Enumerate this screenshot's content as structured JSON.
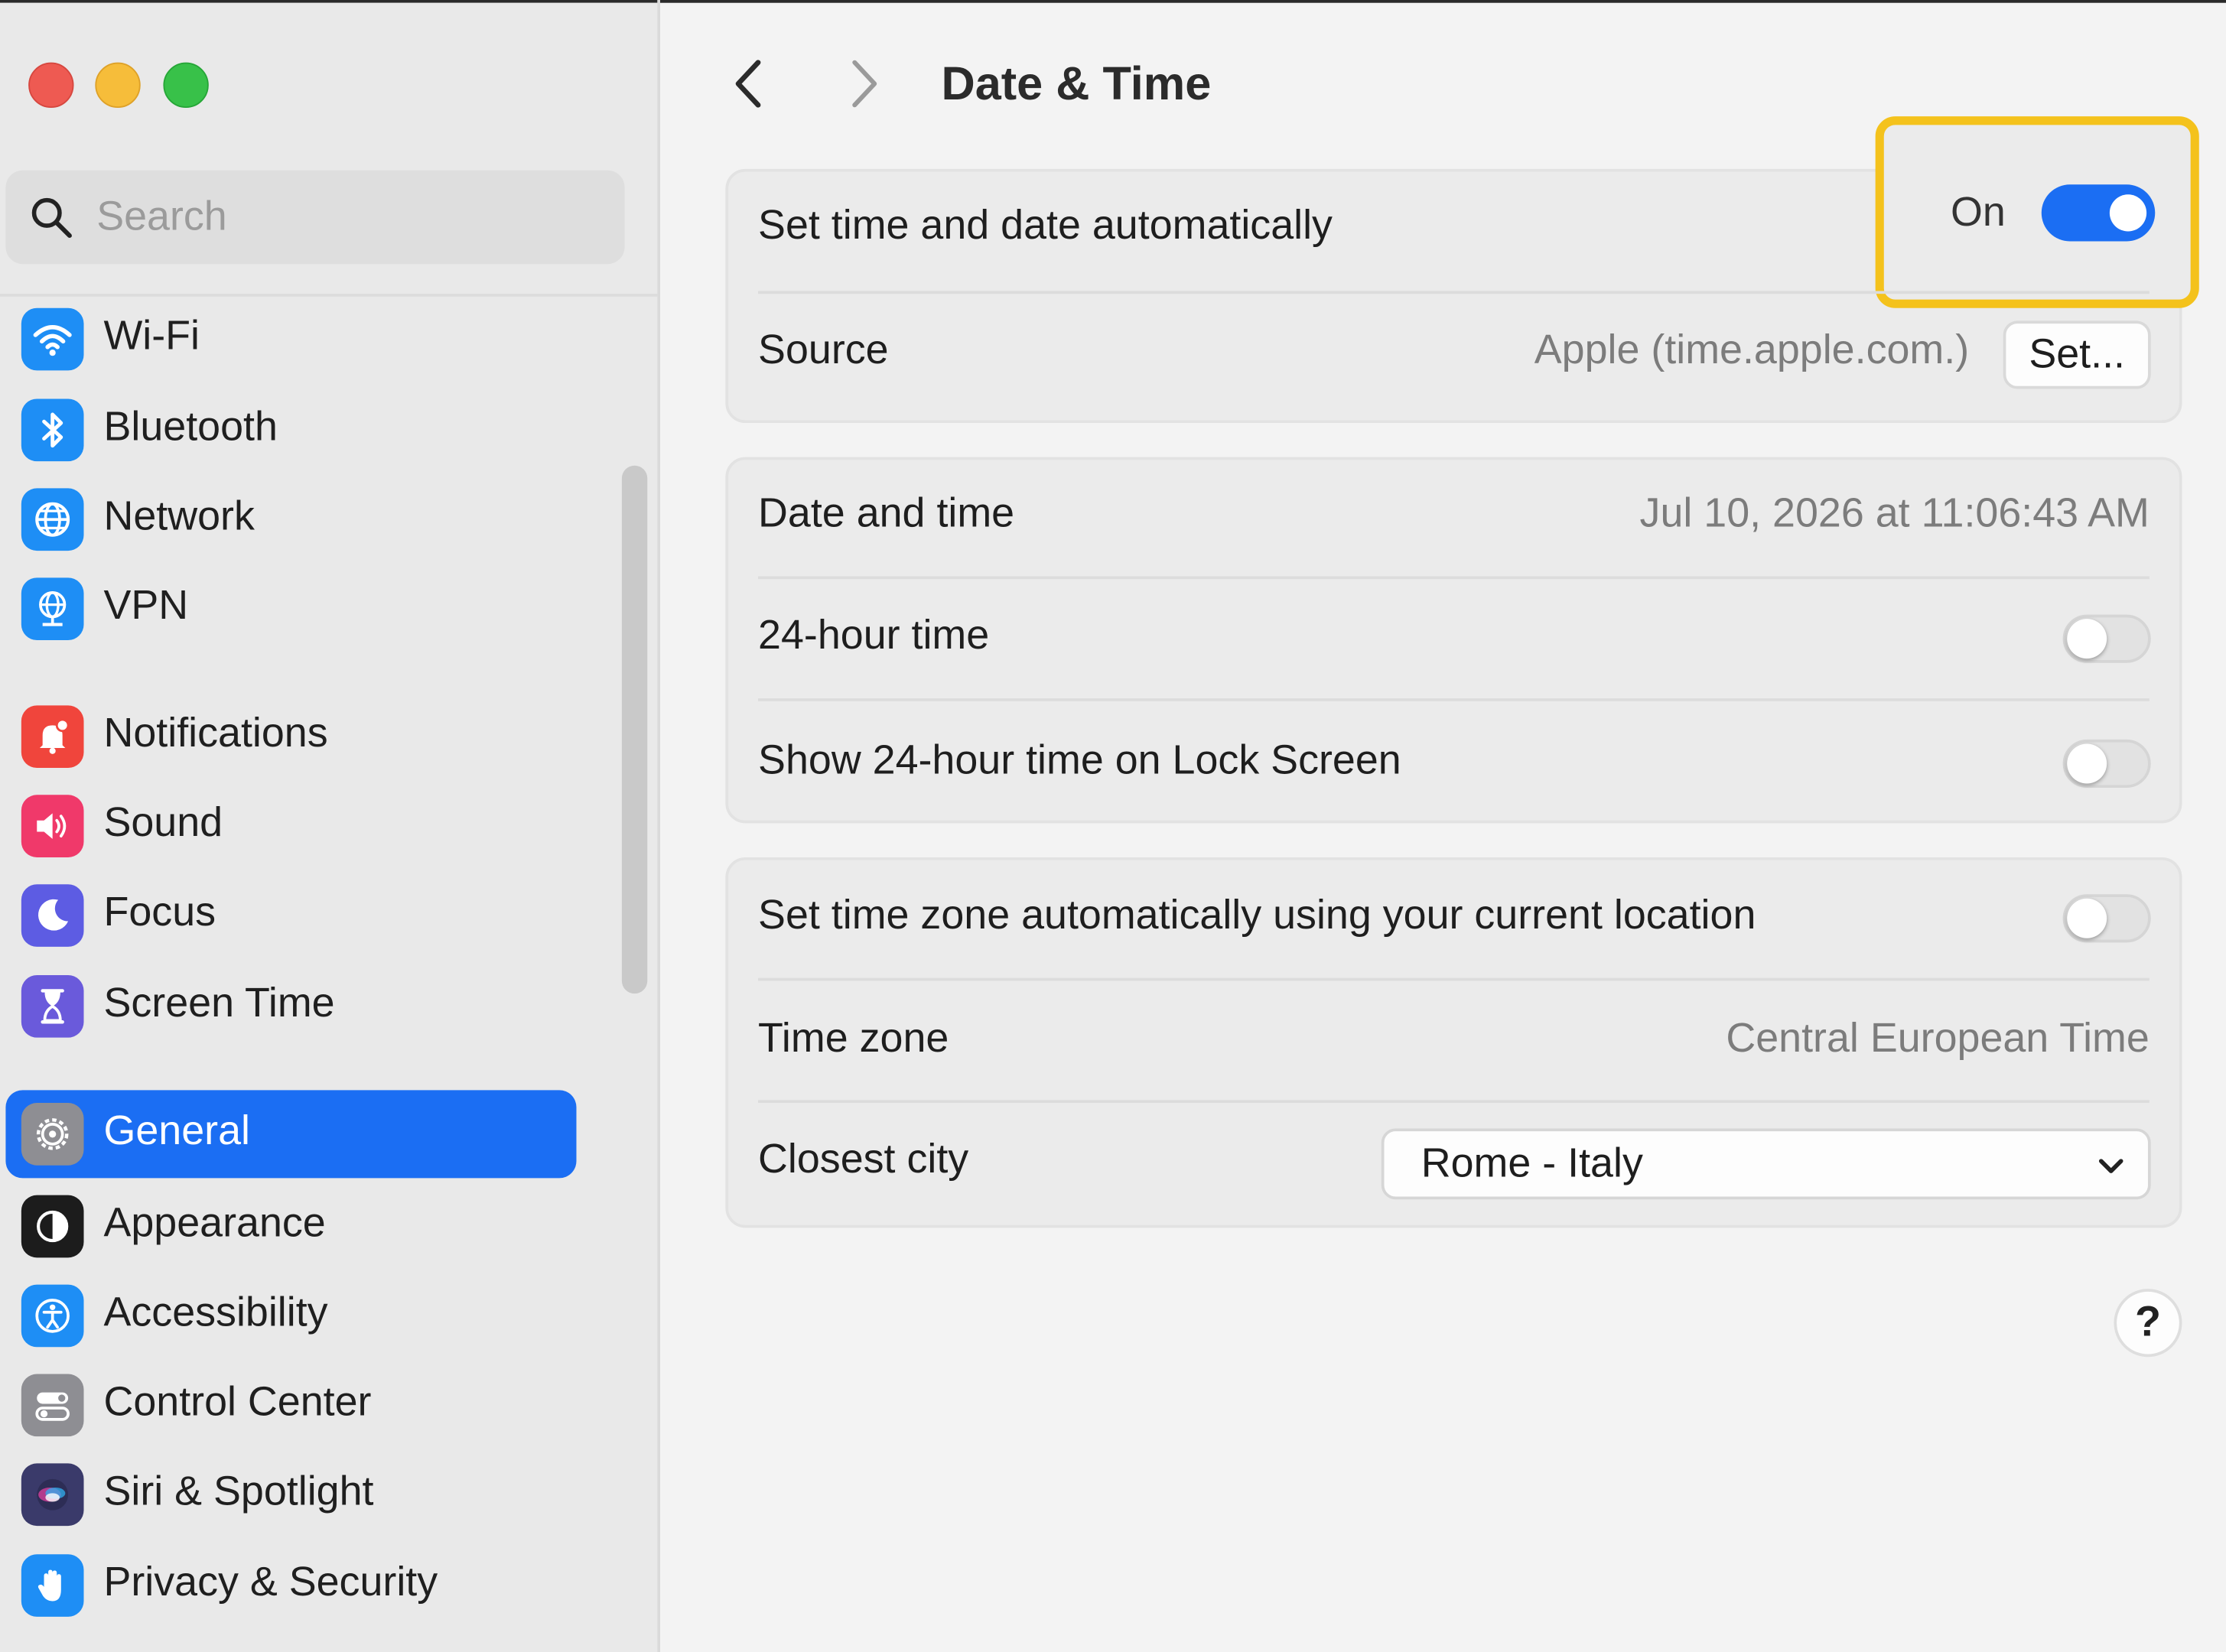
{
  "window": {
    "title": "Date & Time"
  },
  "sidebar": {
    "search": {
      "placeholder": "Search"
    },
    "items": [
      {
        "label": "Wi-Fi",
        "icon": "wifi-icon",
        "color": "#1e8ef5"
      },
      {
        "label": "Bluetooth",
        "icon": "bluetooth-icon",
        "color": "#1e8ef5"
      },
      {
        "label": "Network",
        "icon": "globe-icon",
        "color": "#1e8ef5"
      },
      {
        "label": "VPN",
        "icon": "vpn-globe-icon",
        "color": "#1e8ef5"
      },
      {
        "label": "Notifications",
        "icon": "bell-icon",
        "color": "#f0453c"
      },
      {
        "label": "Sound",
        "icon": "speaker-icon",
        "color": "#f0396a"
      },
      {
        "label": "Focus",
        "icon": "moon-icon",
        "color": "#5d5ce3"
      },
      {
        "label": "Screen Time",
        "icon": "hourglass-icon",
        "color": "#6a5adb"
      },
      {
        "label": "General",
        "icon": "gear-icon",
        "color": "#8e8e93",
        "selected": true
      },
      {
        "label": "Appearance",
        "icon": "appearance-icon",
        "color": "#1c1c1c"
      },
      {
        "label": "Accessibility",
        "icon": "accessibility-icon",
        "color": "#1e8ef5"
      },
      {
        "label": "Control Center",
        "icon": "control-center-icon",
        "color": "#8e8e93"
      },
      {
        "label": "Siri & Spotlight",
        "icon": "siri-icon",
        "color": "#3a3a6a"
      },
      {
        "label": "Privacy & Security",
        "icon": "hand-icon",
        "color": "#1e8ef5"
      }
    ]
  },
  "settings": {
    "auto_time": {
      "label": "Set time and date automatically",
      "state_label": "On",
      "enabled": true
    },
    "source": {
      "label": "Source",
      "value": "Apple (time.apple.com.)",
      "button": "Set..."
    },
    "date_time": {
      "label": "Date and time",
      "value": "Jul 10, 2026 at 11:06:43 AM"
    },
    "hour24": {
      "label": "24-hour time",
      "enabled": false
    },
    "hour24_lock": {
      "label": "Show 24-hour time on Lock Screen",
      "enabled": false
    },
    "auto_timezone": {
      "label": "Set time zone automatically using your current location",
      "enabled": false
    },
    "time_zone": {
      "label": "Time zone",
      "value": "Central European Time"
    },
    "closest_city": {
      "label": "Closest city",
      "value": "Rome - Italy"
    },
    "help": "?"
  },
  "colors": {
    "accent": "#1b6ef3",
    "highlight": "#f4c21c"
  }
}
